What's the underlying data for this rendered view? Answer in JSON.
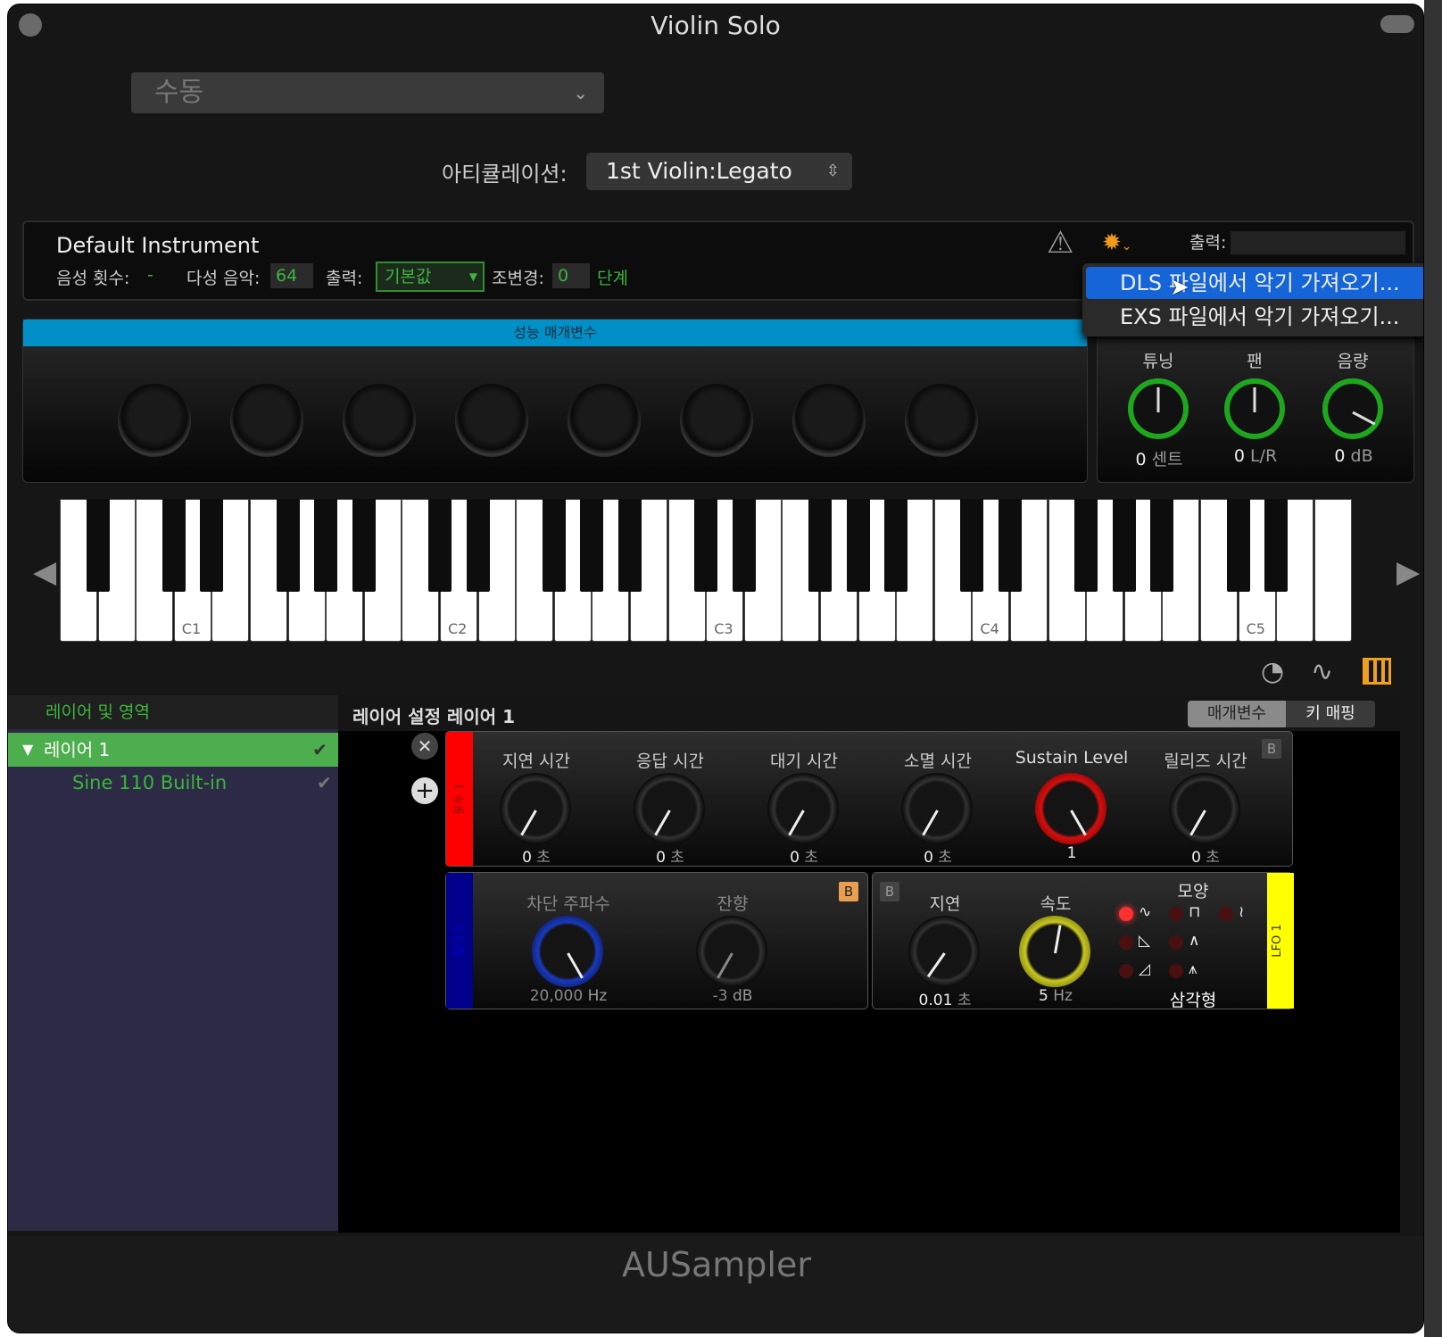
{
  "window": {
    "title": "Violin Solo",
    "footer": "AUSampler"
  },
  "preset": {
    "value": "수동"
  },
  "articulation": {
    "label": "아티큘레이션:",
    "value": "1st Violin:Legato"
  },
  "instrument": {
    "name": "Default Instrument",
    "voice_count_label": "음성 횟수:",
    "voice_count_value": "-",
    "polyphony_label": "다성 음악:",
    "polyphony_value": "64",
    "output_label": "출력:",
    "output_value": "기본값",
    "transpose_label": "조변경:",
    "transpose_value": "0",
    "transpose_unit": "단계",
    "outputs_label": "출력:"
  },
  "menu": {
    "items": [
      "DLS 파일에서 악기 가져오기...",
      "EXS 파일에서 악기 가져오기..."
    ]
  },
  "performance": {
    "header": "성능 매개변수"
  },
  "mix": {
    "knobs": [
      {
        "label": "튜닝",
        "value": "0",
        "unit": "센트"
      },
      {
        "label": "팬",
        "value": "0",
        "unit": "L/R"
      },
      {
        "label": "음량",
        "value": "0",
        "unit": "dB"
      }
    ]
  },
  "keyboard": {
    "labels": [
      "C1",
      "C2",
      "C3",
      "C4",
      "C5"
    ]
  },
  "layers": {
    "header": "레이어 및 영역",
    "layer_name": "레이어 1",
    "zone_name": "Sine 110 Built-in"
  },
  "editor": {
    "title": "레이어 설정 레이어 1",
    "tabs": [
      "매개변수",
      "키 매핑"
    ],
    "envelope": {
      "strip_label": "봉투 1",
      "knobs": [
        {
          "label": "지연 시간",
          "value": "0",
          "unit": "초"
        },
        {
          "label": "응답 시간",
          "value": "0",
          "unit": "초"
        },
        {
          "label": "대기 시간",
          "value": "0",
          "unit": "초"
        },
        {
          "label": "소멸 시간",
          "value": "0",
          "unit": "초"
        },
        {
          "label": "Sustain Level",
          "value": "1",
          "unit": ""
        },
        {
          "label": "릴리즈 시간",
          "value": "0",
          "unit": "초"
        }
      ]
    },
    "filter": {
      "strip_label": "필터 1",
      "knobs": [
        {
          "label": "차단 주파수",
          "value": "20,000",
          "unit": "Hz"
        },
        {
          "label": "잔향",
          "value": "-3",
          "unit": "dB"
        }
      ]
    },
    "lfo": {
      "strip_label": "LFO 1",
      "knobs": [
        {
          "label": "지연",
          "value": "0.01",
          "unit": "초"
        },
        {
          "label": "속도",
          "value": "5",
          "unit": "Hz"
        }
      ],
      "shape_label": "모양",
      "shape_value": "삼각형"
    }
  },
  "colors": {
    "accent_green": "#3db53d",
    "menu_highlight": "#1565d8",
    "perf_header": "#0090c8",
    "env_red": "#ff0000",
    "filter_blue": "#00008b",
    "lfo_yellow": "#ffff00"
  }
}
